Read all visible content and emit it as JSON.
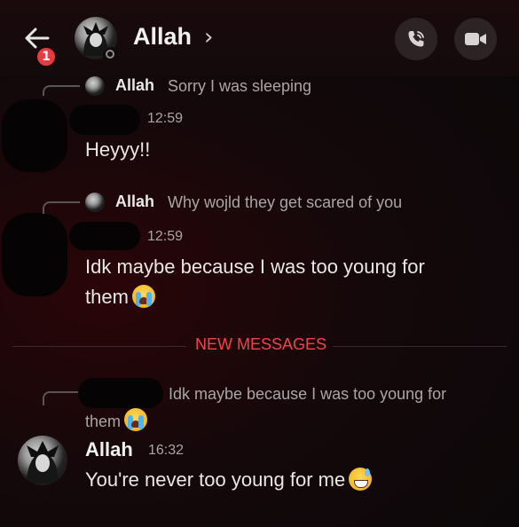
{
  "header": {
    "title": "Allah",
    "chevron": "›",
    "unread_badge": "1",
    "back_icon": "arrow-left-icon",
    "call_icon": "phone-icon",
    "video_icon": "video-camera-icon"
  },
  "messages": [
    {
      "reply_author": "Allah",
      "reply_text": "Sorry I was  sleeping",
      "time": "12:59",
      "text": "Heyyy!!"
    },
    {
      "reply_author": "Allah",
      "reply_text": "Why wojld they get scared of you",
      "time": "12:59",
      "text_line1": "Idk maybe because I was too young for",
      "text_line2": "them"
    }
  ],
  "divider": {
    "label": "NEW MESSAGES"
  },
  "latest": {
    "reply_text_line1": "Idk maybe because I was too young for",
    "reply_text_line2": "them",
    "author": "Allah",
    "time": "16:32",
    "text": "You're never too young for me"
  },
  "colors": {
    "accent_red": "#f0444b",
    "badge_red": "#e83a3f",
    "background": "#14080a"
  }
}
